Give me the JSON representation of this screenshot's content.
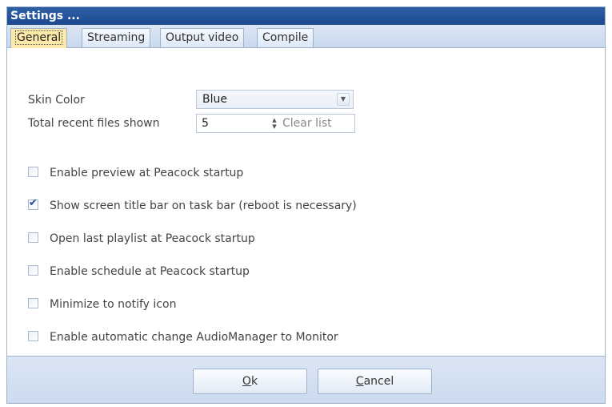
{
  "window": {
    "title": "Settings ..."
  },
  "tabs": [
    {
      "label": "General",
      "active": true
    },
    {
      "label": "Streaming",
      "active": false
    },
    {
      "label": "Output video",
      "active": false
    },
    {
      "label": "Compile",
      "active": false
    }
  ],
  "general": {
    "skin_color": {
      "label": "Skin Color",
      "value": "Blue"
    },
    "recent_files": {
      "label": "Total recent files shown",
      "value": "5",
      "clear_label": "Clear list"
    },
    "options": [
      {
        "label": "Enable preview at Peacock startup",
        "checked": false
      },
      {
        "label": "Show screen title bar on task bar (reboot is necessary)",
        "checked": true
      },
      {
        "label": "Open last playlist at Peacock startup",
        "checked": false
      },
      {
        "label": "Enable schedule at Peacock startup",
        "checked": false
      },
      {
        "label": "Minimize to notify icon",
        "checked": false
      },
      {
        "label": "Enable automatic change AudioManager to Monitor",
        "checked": false
      }
    ]
  },
  "buttons": {
    "ok": {
      "label": "Ok",
      "mnemonic": "O"
    },
    "cancel": {
      "label": "Cancel",
      "mnemonic": "C"
    }
  },
  "colors": {
    "titlebar": "#2459a3",
    "active_tab": "#fdeaa8",
    "chrome": "#d3e0f2",
    "border": "#9fb1cc"
  }
}
